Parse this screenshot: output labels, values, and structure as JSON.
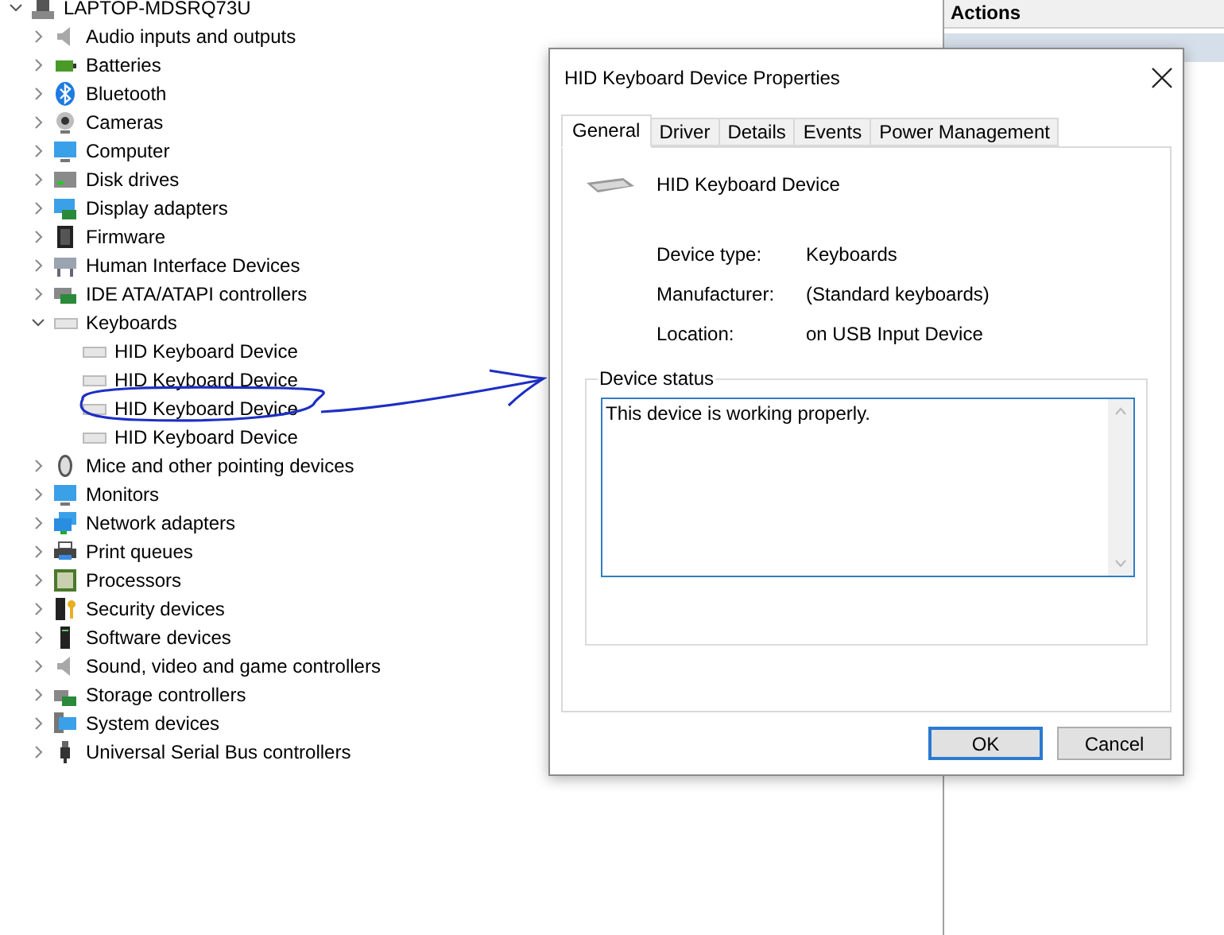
{
  "tree": {
    "label": "LAPTOP-MDSRQ73U",
    "expanded": true,
    "children": [
      {
        "label": "Audio inputs and outputs",
        "expanded": false
      },
      {
        "label": "Batteries",
        "expanded": false
      },
      {
        "label": "Bluetooth",
        "expanded": false
      },
      {
        "label": "Cameras",
        "expanded": false
      },
      {
        "label": "Computer",
        "expanded": false
      },
      {
        "label": "Disk drives",
        "expanded": false
      },
      {
        "label": "Display adapters",
        "expanded": false
      },
      {
        "label": "Firmware",
        "expanded": false
      },
      {
        "label": "Human Interface Devices",
        "expanded": false
      },
      {
        "label": "IDE ATA/ATAPI controllers",
        "expanded": false
      },
      {
        "label": "Keyboards",
        "expanded": true,
        "children": [
          {
            "label": "HID Keyboard Device"
          },
          {
            "label": "HID Keyboard Device"
          },
          {
            "label": "HID Keyboard Device"
          },
          {
            "label": "HID Keyboard Device"
          }
        ]
      },
      {
        "label": "Mice and other pointing devices",
        "expanded": false
      },
      {
        "label": "Monitors",
        "expanded": false
      },
      {
        "label": "Network adapters",
        "expanded": false
      },
      {
        "label": "Print queues",
        "expanded": false
      },
      {
        "label": "Processors",
        "expanded": false
      },
      {
        "label": "Security devices",
        "expanded": false
      },
      {
        "label": "Software devices",
        "expanded": false
      },
      {
        "label": "Sound, video and game controllers",
        "expanded": false
      },
      {
        "label": "Storage controllers",
        "expanded": false
      },
      {
        "label": "System devices",
        "expanded": false
      },
      {
        "label": "Universal Serial Bus controllers",
        "expanded": false
      }
    ]
  },
  "actions": {
    "header": "Actions"
  },
  "dialog": {
    "title": "HID Keyboard Device Properties",
    "tabs": [
      {
        "label": "General",
        "selected": true
      },
      {
        "label": "Driver",
        "selected": false
      },
      {
        "label": "Details",
        "selected": false
      },
      {
        "label": "Events",
        "selected": false
      },
      {
        "label": "Power Management",
        "selected": false
      }
    ],
    "device_name": "HID Keyboard Device",
    "properties": [
      {
        "label": "Device type:",
        "value": "Keyboards"
      },
      {
        "label": "Manufacturer:",
        "value": "(Standard keyboards)"
      },
      {
        "label": "Location:",
        "value": "on USB Input Device"
      }
    ],
    "status_group": "Device status",
    "status_text": "This device is working properly.",
    "buttons": [
      {
        "label": "OK",
        "default": true
      },
      {
        "label": "Cancel",
        "default": false
      }
    ]
  }
}
